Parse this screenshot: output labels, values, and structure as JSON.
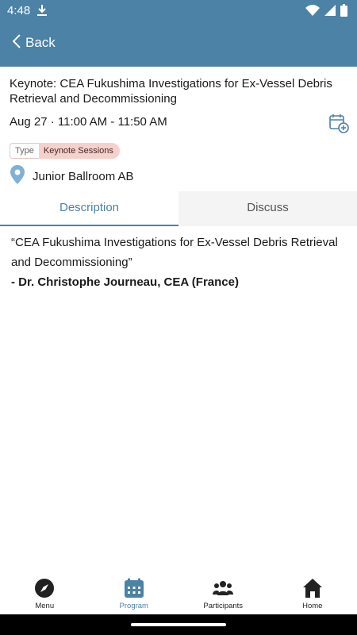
{
  "status_bar": {
    "time": "4:48",
    "icons": [
      "download-icon",
      "wifi-icon",
      "battery-icon"
    ]
  },
  "header": {
    "back_label": "Back",
    "back_icon": "chevron-left-icon",
    "background": "#4c82a6"
  },
  "session": {
    "title": "Keynote: CEA Fukushima Investigations for Ex-Vessel Debris Retrieval and Decommissioning",
    "datetime": "Aug 27 · 11:00 AM - 11:50 AM",
    "add_to_calendar_icon": "calendar-add-icon",
    "type_label": "Type",
    "type_value": "Keynote Sessions",
    "type_color": "#f8d0ca",
    "location": "Junior Ballroom AB",
    "location_icon": "map-pin-icon"
  },
  "tabs": [
    {
      "label": "Description",
      "active": true
    },
    {
      "label": "Discuss",
      "active": false
    }
  ],
  "description": {
    "quote": "“CEA Fukushima Investigations for Ex-Vessel Debris Retrieval and Decommissioning”",
    "author": "- Dr. Christophe Journeau, CEA (France)"
  },
  "bottom_nav": [
    {
      "label": "Menu",
      "icon": "compass-icon",
      "active": false
    },
    {
      "label": "Program",
      "icon": "calendar-icon",
      "active": true
    },
    {
      "label": "Participants",
      "icon": "people-icon",
      "active": false
    },
    {
      "label": "Home",
      "icon": "home-icon",
      "active": false
    }
  ],
  "accent_color": "#4c82a6"
}
